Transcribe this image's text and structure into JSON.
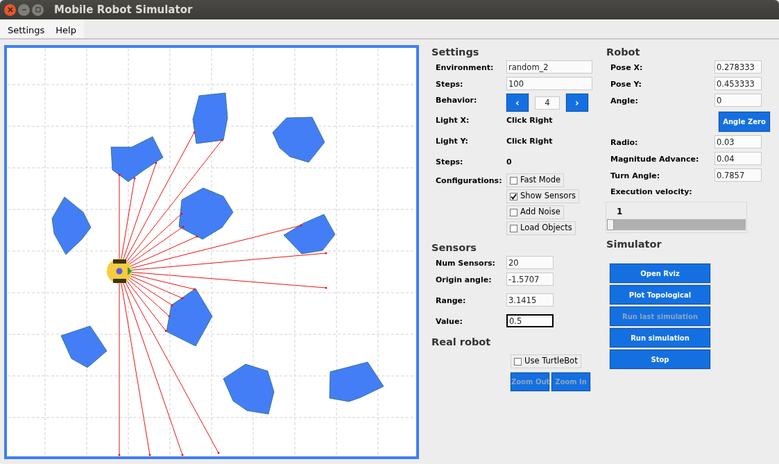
{
  "window": {
    "title": "Mobile Robot Simulator"
  },
  "menu": [
    {
      "label": "Settings"
    },
    {
      "label": "Help"
    }
  ],
  "settings": {
    "heading": "Settings",
    "rows": [
      {
        "kind": "field",
        "label": "Environment:",
        "value": "random_2"
      },
      {
        "kind": "field",
        "label": "Steps:",
        "value": "100"
      },
      {
        "kind": "stepper",
        "label": "Behavior:",
        "prev": "‹",
        "value": "4",
        "next": "›"
      },
      {
        "kind": "text",
        "label": "Light X:",
        "value": "Click Right"
      },
      {
        "kind": "text",
        "label": "Light Y:",
        "value": "Click Right"
      },
      {
        "kind": "text",
        "label": "Steps:",
        "value": "0"
      },
      {
        "kind": "checks",
        "label": "Configurations:",
        "options": [
          {
            "label": "Fast Mode",
            "checked": false
          },
          {
            "label": "Show Sensors",
            "checked": true
          },
          {
            "label": "Add Noise",
            "checked": false
          },
          {
            "label": "Load Objects",
            "checked": false
          }
        ]
      }
    ]
  },
  "sensors": {
    "heading": "Sensors",
    "rows": [
      {
        "kind": "field",
        "label": "Num Sensors:",
        "value": "20",
        "focused": false
      },
      {
        "kind": "field",
        "label": "Origin angle:",
        "value": "-1.5707",
        "focused": false
      },
      {
        "kind": "field",
        "label": "Range:",
        "value": "3.1415",
        "focused": false
      },
      {
        "kind": "field",
        "label": "Value:",
        "value": "0.5",
        "focused": true
      }
    ]
  },
  "real_robot": {
    "heading": "Real robot",
    "options": [
      {
        "label": "Use TurtleBot",
        "checked": false
      }
    ],
    "buttons": [
      {
        "label": "Zoom Out",
        "disabled": true
      },
      {
        "label": "Zoom In",
        "disabled": true
      }
    ]
  },
  "robot": {
    "heading": "Robot",
    "rows": [
      {
        "kind": "field",
        "label": "Pose X:",
        "value": "0.278333"
      },
      {
        "kind": "field",
        "label": "Pose Y:",
        "value": "0.453333"
      },
      {
        "kind": "field",
        "label": "Angle:",
        "value": "0"
      },
      {
        "kind": "button",
        "label": "Angle Zero"
      },
      {
        "kind": "field",
        "label": "Radio:",
        "value": "0.03"
      },
      {
        "kind": "field",
        "label": "Magnitude Advance:",
        "value": "0.04"
      },
      {
        "kind": "field",
        "label": "Turn Angle:",
        "value": "0.7857"
      }
    ]
  },
  "velocity": {
    "label": "Execution velocity:",
    "reading": "1",
    "level": 0
  },
  "simulator": {
    "heading": "Simulator",
    "buttons": [
      {
        "label": "Open Rviz",
        "disabled": false
      },
      {
        "label": "Plot Topological",
        "disabled": false
      },
      {
        "label": "Run last simulation",
        "disabled": true
      },
      {
        "label": "Run simulation",
        "disabled": false
      },
      {
        "label": "Stop",
        "disabled": false
      }
    ]
  }
}
